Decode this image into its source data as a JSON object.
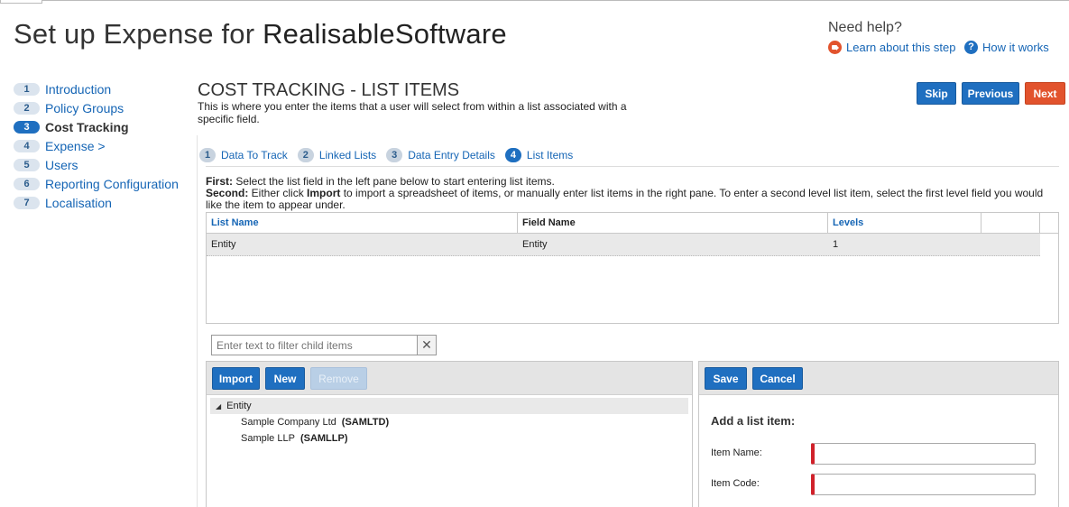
{
  "header": {
    "title_prefix": "Set up Expense for ",
    "company": "RealisableSoftware"
  },
  "help": {
    "title": "Need help?",
    "learn_link": "Learn about this step",
    "how_link": "How it works",
    "learn_icon": "video-icon",
    "how_icon": "question-icon"
  },
  "steps": [
    {
      "num": "1",
      "label": "Introduction",
      "active": false
    },
    {
      "num": "2",
      "label": "Policy Groups",
      "active": false
    },
    {
      "num": "3",
      "label": "Cost Tracking",
      "active": true
    },
    {
      "num": "4",
      "label": "Expense >",
      "active": false
    },
    {
      "num": "5",
      "label": "Users",
      "active": false
    },
    {
      "num": "6",
      "label": "Reporting Configuration",
      "active": false
    },
    {
      "num": "7",
      "label": "Localisation",
      "active": false
    }
  ],
  "section": {
    "title": "COST TRACKING - LIST ITEMS",
    "description": "This is where you enter the items that a user will select from within a list associated with a specific field."
  },
  "nav_buttons": {
    "skip": "Skip",
    "previous": "Previous",
    "next": "Next"
  },
  "subtabs": [
    {
      "num": "1",
      "label": "Data To Track",
      "active": false
    },
    {
      "num": "2",
      "label": "Linked Lists",
      "active": false
    },
    {
      "num": "3",
      "label": "Data Entry Details",
      "active": false
    },
    {
      "num": "4",
      "label": "List Items",
      "active": true
    }
  ],
  "instructions": {
    "first_label": "First:",
    "first_text": " Select the list field in the left pane below to start entering list items.",
    "second_label": "Second:",
    "second_text_a": " Either click ",
    "second_import": "Import",
    "second_text_b": " to import a spreadsheet of items, or manually enter list items in the right pane. To enter a second level list item, select the first level field you would like the item to appear under."
  },
  "list_table": {
    "columns": [
      "List Name",
      "Field Name",
      "Levels",
      ""
    ],
    "rows": [
      {
        "list_name": "Entity",
        "field_name": "Entity",
        "levels": "1"
      }
    ]
  },
  "filter": {
    "placeholder": "Enter text to filter child items",
    "value": ""
  },
  "left_toolbar": {
    "import": "Import",
    "new": "New",
    "remove": "Remove"
  },
  "tree": {
    "root": "Entity",
    "children": [
      {
        "name": "Sample Company Ltd",
        "code": "(SAMLTD)"
      },
      {
        "name": "Sample LLP",
        "code": "(SAMLLP)"
      }
    ]
  },
  "right_toolbar": {
    "save": "Save",
    "cancel": "Cancel"
  },
  "form": {
    "title": "Add a list item:",
    "item_name_label": "Item Name:",
    "item_code_label": "Item Code:",
    "item_name_value": "",
    "item_code_value": ""
  },
  "colors": {
    "accent_blue": "#1f6fc0",
    "next_orange": "#e2532d",
    "required_red": "#d0212a"
  }
}
